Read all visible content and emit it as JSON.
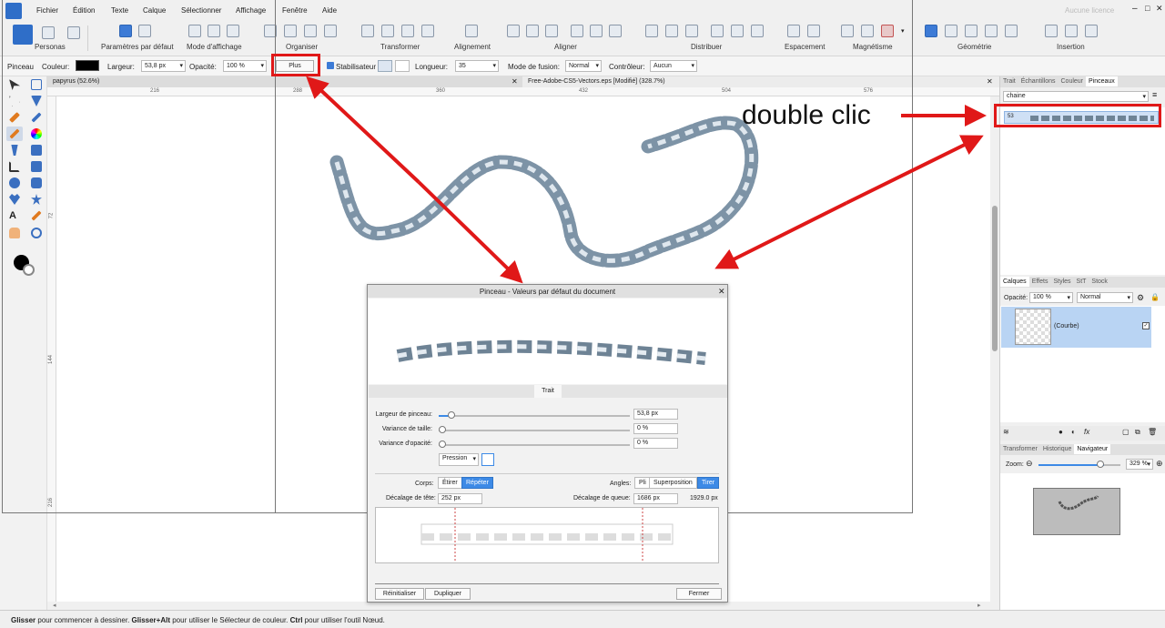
{
  "menubar": {
    "items": [
      "Fichier",
      "Édition",
      "Texte",
      "Calque",
      "Sélectionner",
      "Affichage",
      "Fenêtre",
      "Aide"
    ],
    "account_text": "Aucune licence"
  },
  "toolbar": {
    "groups": [
      "Personas",
      "Paramètres par défaut",
      "Mode d'affichage",
      "Organiser",
      "Transformer",
      "Alignement",
      "Aligner",
      "Distribuer",
      "Espacement",
      "Magnétisme",
      "Géométrie",
      "Insertion"
    ]
  },
  "context": {
    "tool": "Pinceau",
    "color_label": "Couleur:",
    "color_value": "#000000",
    "width_label": "Largeur:",
    "width_value": "53,8 px",
    "opacity_label": "Opacité:",
    "opacity_value": "100 %",
    "more_button": "Plus",
    "stabilizer_label": "Stabilisateur",
    "length_label": "Longueur:",
    "length_value": "35",
    "blend_label": "Mode de fusion:",
    "blend_value": "Normal",
    "controller_label": "Contrôleur:",
    "controller_value": "Aucun"
  },
  "doc_tabs": [
    "papyrus (52.6%)",
    "Free-Adobe-CS5-Vectors.eps [Modifié] (328.7%)"
  ],
  "ruler": {
    "h_ticks": [
      "216",
      "288",
      "360",
      "432",
      "504",
      "576"
    ],
    "v_ticks": [
      "72",
      "144",
      "216"
    ]
  },
  "dialog": {
    "title": "Pinceau - Valeurs par défaut du document",
    "section": "Trait",
    "brush_width_label": "Largeur de pinceau:",
    "brush_width_value": "53,8 px",
    "brush_width_level": 0.05,
    "size_var_label": "Variance de taille:",
    "size_var_value": "0 %",
    "opacity_var_label": "Variance d'opacité:",
    "opacity_var_value": "0 %",
    "pressure_label": "Pression",
    "body_label": "Corps:",
    "body_stretch": "Étirer",
    "body_repeat": "Répéter",
    "angles_label": "Angles:",
    "angle_fold": "Pli",
    "angle_overlap": "Superposition",
    "angle_pull": "Tirer",
    "head_offset_label": "Décalage de tête:",
    "head_offset_value": "252 px",
    "tail_offset_label": "Décalage de queue:",
    "tail_offset_value": "1686 px",
    "total_width": "1929.0 px",
    "reset_button": "Réinitialiser",
    "duplicate_button": "Dupliquer",
    "close_button": "Fermer"
  },
  "right_panel": {
    "top_tabs": [
      "Trait",
      "Échantillons",
      "Couleur",
      "Pinceaux"
    ],
    "category": "chaine",
    "layers_tabs": [
      "Calques",
      "Effets",
      "Styles",
      "StT",
      "Stock"
    ],
    "layers_opacity_label": "Opacité:",
    "layers_opacity_value": "100 %",
    "layers_blend": "Normal",
    "layer_name": "(Courbe)",
    "nav_tabs": [
      "Transformer",
      "Historique",
      "Navigateur"
    ],
    "zoom_label": "Zoom:",
    "zoom_value": "329 %",
    "zoom_level": 0.8
  },
  "annotation": {
    "text": "double clic",
    "accent": "#e01818"
  },
  "status": {
    "text_1": "Glisser",
    "text_2": " pour commencer à dessiner. ",
    "text_3": "Glisser+Alt",
    "text_4": " pour utiliser le Sélecteur de couleur. ",
    "text_5": "Ctrl",
    "text_6": " pour utiliser l'outil Nœud."
  }
}
